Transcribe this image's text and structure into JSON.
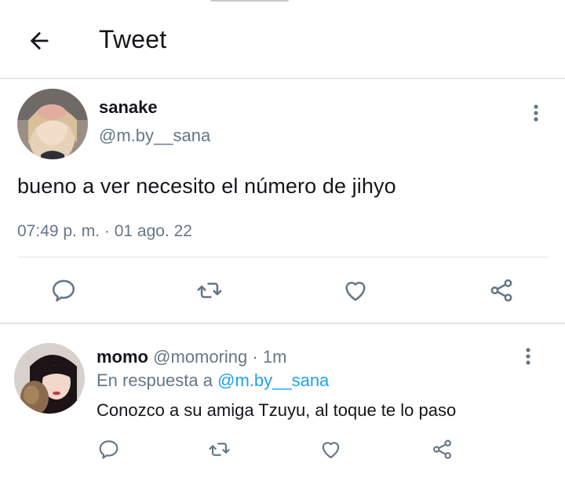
{
  "header": {
    "title": "Tweet",
    "back_icon": "arrow-left-icon"
  },
  "tweet": {
    "display_name": "sanake",
    "handle": "@m.by__sana",
    "text": "bueno a ver necesito el número de jihyo",
    "timestamp": "07:49 p. m. · 01 ago. 22",
    "actions": [
      "reply-icon",
      "retweet-icon",
      "like-icon",
      "share-icon"
    ]
  },
  "reply": {
    "display_name": "momo",
    "handle": "@momoring",
    "separator": "·",
    "time": "1m",
    "reply_prefix": "En respuesta a",
    "reply_to": "@m.by__sana",
    "text": "Conozco a su amiga Tzuyu, al toque te lo paso",
    "actions": [
      "reply-icon",
      "retweet-icon",
      "like-icon",
      "share-icon"
    ]
  },
  "colors": {
    "text_primary": "#14171a",
    "text_secondary": "#657786",
    "accent": "#1da1f2",
    "divider": "#e3e6e8",
    "icon": "#657786"
  }
}
